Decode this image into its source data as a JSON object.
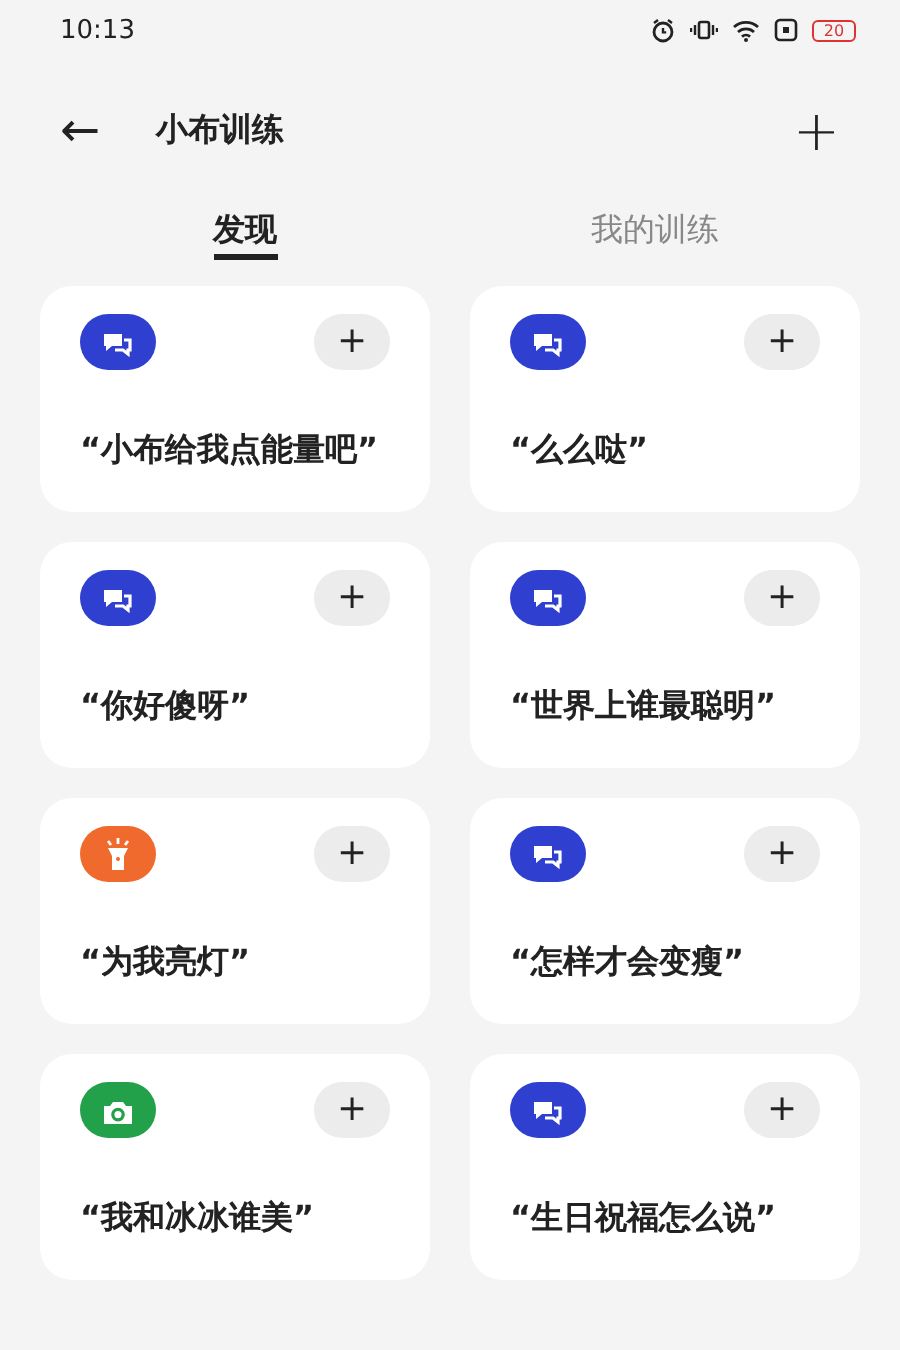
{
  "status_bar": {
    "time": "10:13",
    "battery": "20"
  },
  "header": {
    "back": "←",
    "title": "小布训练",
    "add": "+"
  },
  "tabs": [
    {
      "label": "发现",
      "selected": true
    },
    {
      "label": "我的训练",
      "selected": false
    }
  ],
  "cards": [
    {
      "kind": "chat",
      "color": "#2f3fd0",
      "text": "“小布给我点能量吧”",
      "add": "+"
    },
    {
      "kind": "chat",
      "color": "#2f3fd0",
      "text": "“么么哒”",
      "add": "+"
    },
    {
      "kind": "chat",
      "color": "#2f3fd0",
      "text": "“你好傻呀”",
      "add": "+"
    },
    {
      "kind": "chat",
      "color": "#2f3fd0",
      "text": "“世界上谁最聪明”",
      "add": "+"
    },
    {
      "kind": "flashlight",
      "color": "#f06a2e",
      "text": "“为我亮灯”",
      "add": "+"
    },
    {
      "kind": "chat",
      "color": "#2f3fd0",
      "text": "“怎样才会变瘦”",
      "add": "+"
    },
    {
      "kind": "camera",
      "color": "#22a04a",
      "text": "“我和冰冰谁美”",
      "add": "+"
    },
    {
      "kind": "chat",
      "color": "#2f3fd0",
      "text": "“生日祝福怎么说”",
      "add": "+"
    }
  ]
}
